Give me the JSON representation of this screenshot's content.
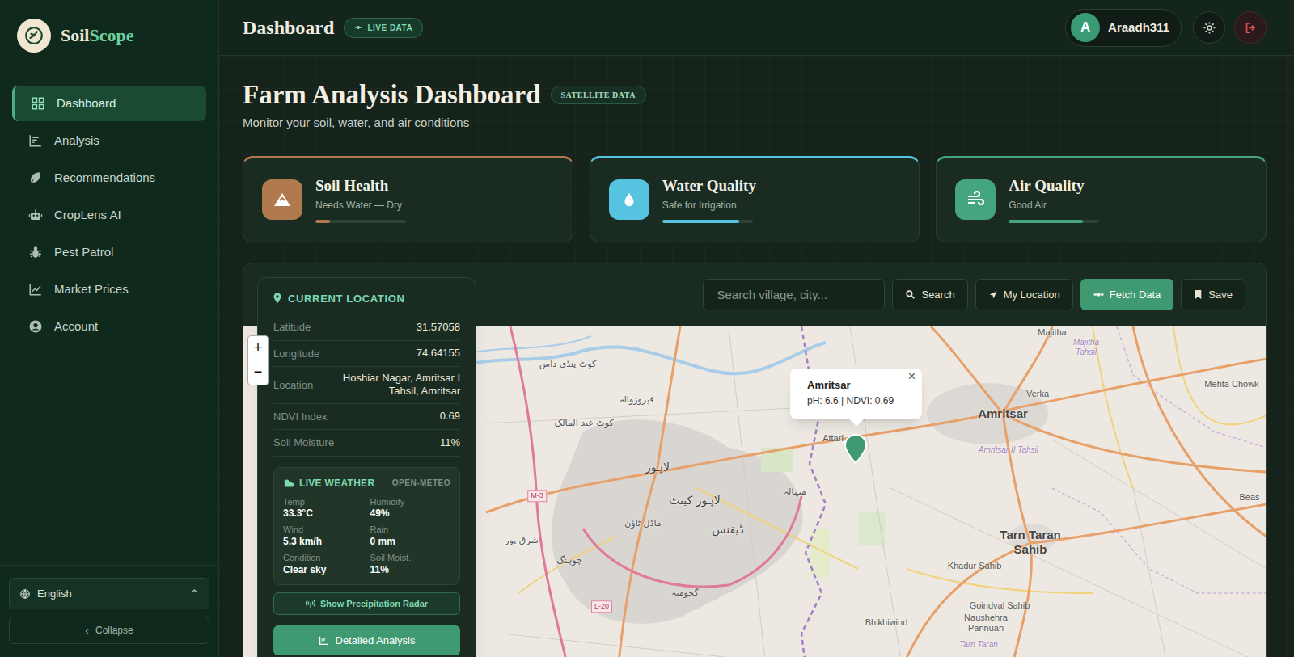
{
  "sidebar": {
    "logo": {
      "part1": "Soil",
      "part2": "Scope"
    },
    "items": [
      {
        "label": "Dashboard",
        "selected": true
      },
      {
        "label": "Analysis",
        "selected": false
      },
      {
        "label": "Recommendations",
        "selected": false
      },
      {
        "label": "CropLens AI",
        "selected": false
      },
      {
        "label": "Pest Patrol",
        "selected": false
      },
      {
        "label": "Market Prices",
        "selected": false
      },
      {
        "label": "Account",
        "selected": false
      }
    ],
    "language": "English",
    "language_caret": "⌃",
    "collapse_icon": "‹",
    "collapse": "Collapse"
  },
  "header": {
    "title": "Dashboard",
    "badge": "LIVE DATA",
    "user": {
      "initial": "A",
      "name": "Araadh311"
    }
  },
  "page": {
    "title": "Farm Analysis Dashboard",
    "badge": "SATELLITE DATA",
    "subtitle": "Monitor your soil, water, and air conditions"
  },
  "cards": [
    {
      "kind": "soil",
      "title": "Soil Health",
      "status": "Needs Water — Dry",
      "level": 0.16,
      "color": "#b07a4e"
    },
    {
      "kind": "water",
      "title": "Water Quality",
      "status": "Safe for Irrigation",
      "level": 0.85,
      "color": "#56c3e0"
    },
    {
      "kind": "air",
      "title": "Air Quality",
      "status": "Good Air",
      "level": 0.82,
      "color": "#44a57f"
    }
  ],
  "toolbar": {
    "search_placeholder": "Search village, city...",
    "buttons": [
      {
        "label": "Search",
        "primary": false
      },
      {
        "label": "My Location",
        "primary": false
      },
      {
        "label": "Fetch Data",
        "primary": true
      },
      {
        "label": "Save",
        "primary": false
      }
    ]
  },
  "location_panel": {
    "title": "CURRENT LOCATION",
    "rows": [
      {
        "label": "Latitude",
        "value": "31.57058"
      },
      {
        "label": "Longitude",
        "value": "74.64155"
      },
      {
        "label": "Location",
        "value": "Hoshiar Nagar, Amritsar I Tahsil, Amritsar"
      },
      {
        "label": "NDVI Index",
        "value": "0.69"
      },
      {
        "label": "Soil Moisture",
        "value": "11%"
      }
    ],
    "weather": {
      "title": "LIVE WEATHER",
      "source": "OPEN-METEO",
      "items": [
        {
          "label": "Temp",
          "value": "33.3°C"
        },
        {
          "label": "Humidity",
          "value": "49%"
        },
        {
          "label": "Wind",
          "value": "5.3 km/h"
        },
        {
          "label": "Rain",
          "value": "0 mm"
        },
        {
          "label": "Condition",
          "value": "Clear sky"
        },
        {
          "label": "Soil Moist.",
          "value": "11%"
        }
      ]
    },
    "radar_button": "Show Precipitation Radar",
    "analysis_button": "Detailed Analysis"
  },
  "map": {
    "zoom_in": "+",
    "zoom_out": "−",
    "popup": {
      "title": "Amritsar",
      "body": "pH: 6.6 | NDVI: 0.69",
      "close": "×"
    },
    "labels": [
      {
        "text": "Amritsar",
        "kind": "city"
      },
      {
        "text": "Verka",
        "kind": "town"
      },
      {
        "text": "Majitha",
        "kind": "town"
      },
      {
        "text": "Majitha Tahsil",
        "kind": "tahsil"
      },
      {
        "text": "Mehta Chowk",
        "kind": "town"
      },
      {
        "text": "Beas",
        "kind": "town"
      },
      {
        "text": "Attari",
        "kind": "town"
      },
      {
        "text": "Amritsar II Tahsil",
        "kind": "tahsil"
      },
      {
        "text": "Tarn Taran Sahib",
        "kind": "city"
      },
      {
        "text": "Khadur Sahib",
        "kind": "town"
      },
      {
        "text": "Goindval Sahib",
        "kind": "town"
      },
      {
        "text": "Naushehra Pannuan",
        "kind": "town"
      },
      {
        "text": "Bhikhiwind",
        "kind": "town"
      },
      {
        "text": "Tarn Taran",
        "kind": "tahsil"
      },
      {
        "text": "لاہور",
        "kind": "urdu-city"
      },
      {
        "text": "لاہور کینٹ",
        "kind": "urdu-city"
      },
      {
        "text": "ڈیفنس",
        "kind": "urdu-city"
      },
      {
        "text": "فیروزوالہ",
        "kind": "urdu"
      },
      {
        "text": "کوٹ پنڈی داس",
        "kind": "urdu"
      },
      {
        "text": "کوٹ عبد المالک",
        "kind": "urdu"
      },
      {
        "text": "ماڈل ٹاؤن",
        "kind": "urdu"
      },
      {
        "text": "شرق پور",
        "kind": "urdu"
      },
      {
        "text": "چوہنگ",
        "kind": "urdu"
      },
      {
        "text": "گجومتہ",
        "kind": "urdu"
      },
      {
        "text": "منہالہ",
        "kind": "urdu"
      },
      {
        "text": "M-3",
        "kind": "road"
      },
      {
        "text": "L-20",
        "kind": "road"
      }
    ]
  }
}
